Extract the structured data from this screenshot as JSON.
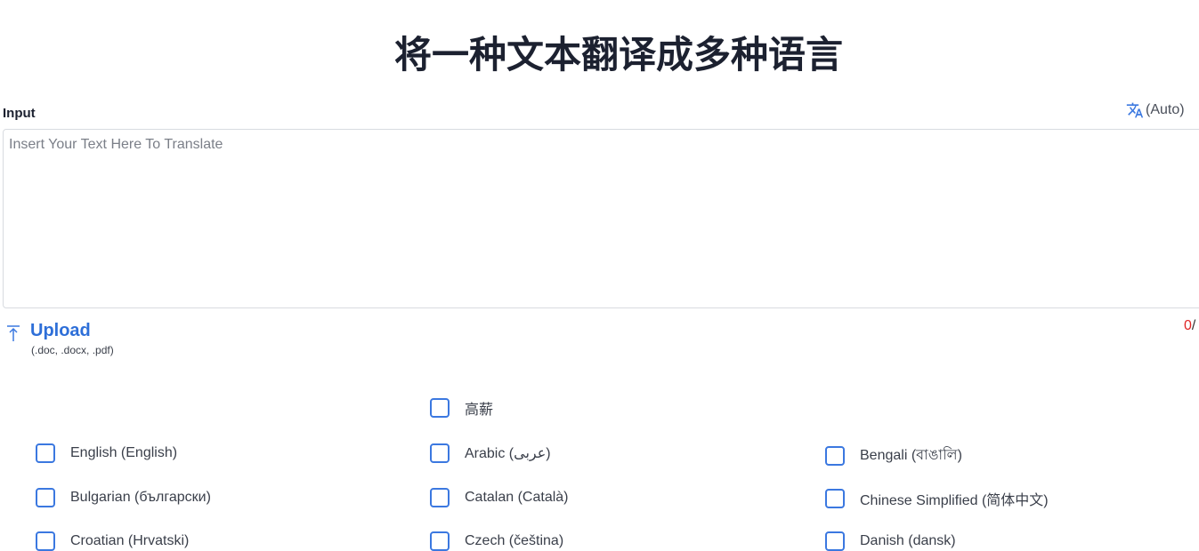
{
  "title": "将一种文本翻译成多种语言",
  "input": {
    "label": "Input",
    "placeholder": "Insert Your Text Here To Translate",
    "value": ""
  },
  "detect": {
    "label": "(Auto)",
    "icon": "translate-icon",
    "accent": "#3b78e0"
  },
  "upload": {
    "label": "Upload",
    "hint": "(.doc, .docx, .pdf)",
    "icon": "upload-icon",
    "color": "#2e6fd8"
  },
  "counter": {
    "count": "0",
    "slash": "/"
  },
  "languages": {
    "top": {
      "label": "高薪",
      "checked": false
    },
    "rows": [
      [
        {
          "label": "English (English)",
          "checked": false
        },
        {
          "label": "Arabic (عربى)",
          "checked": false
        },
        {
          "label": "Bengali (বাঙালি)",
          "checked": false
        }
      ],
      [
        {
          "label": "Bulgarian (български)",
          "checked": false
        },
        {
          "label": "Catalan (Català)",
          "checked": false
        },
        {
          "label": "Chinese Simplified (简体中文)",
          "checked": false
        }
      ],
      [
        {
          "label": "Croatian (Hrvatski)",
          "checked": false
        },
        {
          "label": "Czech (čeština)",
          "checked": false
        },
        {
          "label": "Danish (dansk)",
          "checked": false
        }
      ]
    ]
  }
}
